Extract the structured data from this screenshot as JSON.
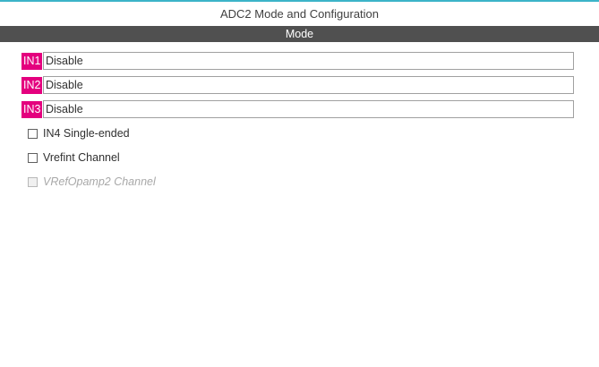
{
  "window": {
    "title": "ADC2 Mode and Configuration"
  },
  "section": {
    "title": "Mode"
  },
  "channels": [
    {
      "label": "IN1",
      "value": "Disable"
    },
    {
      "label": "IN2",
      "value": "Disable"
    },
    {
      "label": "IN3",
      "value": "Disable"
    }
  ],
  "checkboxes": [
    {
      "label": "IN4 Single-ended",
      "checked": false,
      "enabled": true
    },
    {
      "label": "Vrefint Channel",
      "checked": false,
      "enabled": true
    },
    {
      "label": "VRefOpamp2 Channel",
      "checked": false,
      "enabled": false
    }
  ],
  "colors": {
    "accent_top": "#3cb4c8",
    "section_bar": "#505050",
    "pin_label": "#e4007e"
  }
}
